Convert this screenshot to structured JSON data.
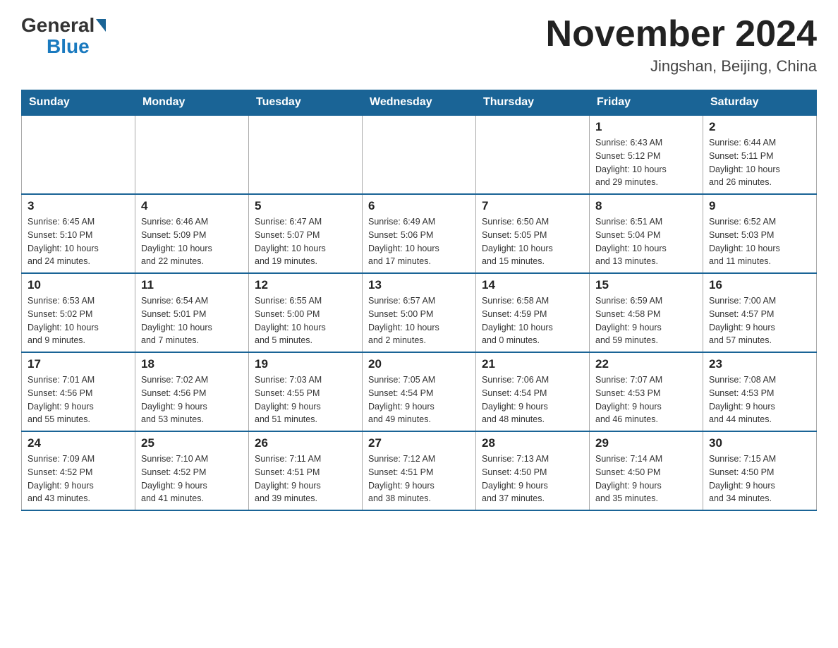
{
  "header": {
    "logo_general": "General",
    "logo_blue": "Blue",
    "month_title": "November 2024",
    "location": "Jingshan, Beijing, China"
  },
  "days_of_week": [
    "Sunday",
    "Monday",
    "Tuesday",
    "Wednesday",
    "Thursday",
    "Friday",
    "Saturday"
  ],
  "weeks": [
    [
      {
        "day": "",
        "info": ""
      },
      {
        "day": "",
        "info": ""
      },
      {
        "day": "",
        "info": ""
      },
      {
        "day": "",
        "info": ""
      },
      {
        "day": "",
        "info": ""
      },
      {
        "day": "1",
        "info": "Sunrise: 6:43 AM\nSunset: 5:12 PM\nDaylight: 10 hours\nand 29 minutes."
      },
      {
        "day": "2",
        "info": "Sunrise: 6:44 AM\nSunset: 5:11 PM\nDaylight: 10 hours\nand 26 minutes."
      }
    ],
    [
      {
        "day": "3",
        "info": "Sunrise: 6:45 AM\nSunset: 5:10 PM\nDaylight: 10 hours\nand 24 minutes."
      },
      {
        "day": "4",
        "info": "Sunrise: 6:46 AM\nSunset: 5:09 PM\nDaylight: 10 hours\nand 22 minutes."
      },
      {
        "day": "5",
        "info": "Sunrise: 6:47 AM\nSunset: 5:07 PM\nDaylight: 10 hours\nand 19 minutes."
      },
      {
        "day": "6",
        "info": "Sunrise: 6:49 AM\nSunset: 5:06 PM\nDaylight: 10 hours\nand 17 minutes."
      },
      {
        "day": "7",
        "info": "Sunrise: 6:50 AM\nSunset: 5:05 PM\nDaylight: 10 hours\nand 15 minutes."
      },
      {
        "day": "8",
        "info": "Sunrise: 6:51 AM\nSunset: 5:04 PM\nDaylight: 10 hours\nand 13 minutes."
      },
      {
        "day": "9",
        "info": "Sunrise: 6:52 AM\nSunset: 5:03 PM\nDaylight: 10 hours\nand 11 minutes."
      }
    ],
    [
      {
        "day": "10",
        "info": "Sunrise: 6:53 AM\nSunset: 5:02 PM\nDaylight: 10 hours\nand 9 minutes."
      },
      {
        "day": "11",
        "info": "Sunrise: 6:54 AM\nSunset: 5:01 PM\nDaylight: 10 hours\nand 7 minutes."
      },
      {
        "day": "12",
        "info": "Sunrise: 6:55 AM\nSunset: 5:00 PM\nDaylight: 10 hours\nand 5 minutes."
      },
      {
        "day": "13",
        "info": "Sunrise: 6:57 AM\nSunset: 5:00 PM\nDaylight: 10 hours\nand 2 minutes."
      },
      {
        "day": "14",
        "info": "Sunrise: 6:58 AM\nSunset: 4:59 PM\nDaylight: 10 hours\nand 0 minutes."
      },
      {
        "day": "15",
        "info": "Sunrise: 6:59 AM\nSunset: 4:58 PM\nDaylight: 9 hours\nand 59 minutes."
      },
      {
        "day": "16",
        "info": "Sunrise: 7:00 AM\nSunset: 4:57 PM\nDaylight: 9 hours\nand 57 minutes."
      }
    ],
    [
      {
        "day": "17",
        "info": "Sunrise: 7:01 AM\nSunset: 4:56 PM\nDaylight: 9 hours\nand 55 minutes."
      },
      {
        "day": "18",
        "info": "Sunrise: 7:02 AM\nSunset: 4:56 PM\nDaylight: 9 hours\nand 53 minutes."
      },
      {
        "day": "19",
        "info": "Sunrise: 7:03 AM\nSunset: 4:55 PM\nDaylight: 9 hours\nand 51 minutes."
      },
      {
        "day": "20",
        "info": "Sunrise: 7:05 AM\nSunset: 4:54 PM\nDaylight: 9 hours\nand 49 minutes."
      },
      {
        "day": "21",
        "info": "Sunrise: 7:06 AM\nSunset: 4:54 PM\nDaylight: 9 hours\nand 48 minutes."
      },
      {
        "day": "22",
        "info": "Sunrise: 7:07 AM\nSunset: 4:53 PM\nDaylight: 9 hours\nand 46 minutes."
      },
      {
        "day": "23",
        "info": "Sunrise: 7:08 AM\nSunset: 4:53 PM\nDaylight: 9 hours\nand 44 minutes."
      }
    ],
    [
      {
        "day": "24",
        "info": "Sunrise: 7:09 AM\nSunset: 4:52 PM\nDaylight: 9 hours\nand 43 minutes."
      },
      {
        "day": "25",
        "info": "Sunrise: 7:10 AM\nSunset: 4:52 PM\nDaylight: 9 hours\nand 41 minutes."
      },
      {
        "day": "26",
        "info": "Sunrise: 7:11 AM\nSunset: 4:51 PM\nDaylight: 9 hours\nand 39 minutes."
      },
      {
        "day": "27",
        "info": "Sunrise: 7:12 AM\nSunset: 4:51 PM\nDaylight: 9 hours\nand 38 minutes."
      },
      {
        "day": "28",
        "info": "Sunrise: 7:13 AM\nSunset: 4:50 PM\nDaylight: 9 hours\nand 37 minutes."
      },
      {
        "day": "29",
        "info": "Sunrise: 7:14 AM\nSunset: 4:50 PM\nDaylight: 9 hours\nand 35 minutes."
      },
      {
        "day": "30",
        "info": "Sunrise: 7:15 AM\nSunset: 4:50 PM\nDaylight: 9 hours\nand 34 minutes."
      }
    ]
  ]
}
